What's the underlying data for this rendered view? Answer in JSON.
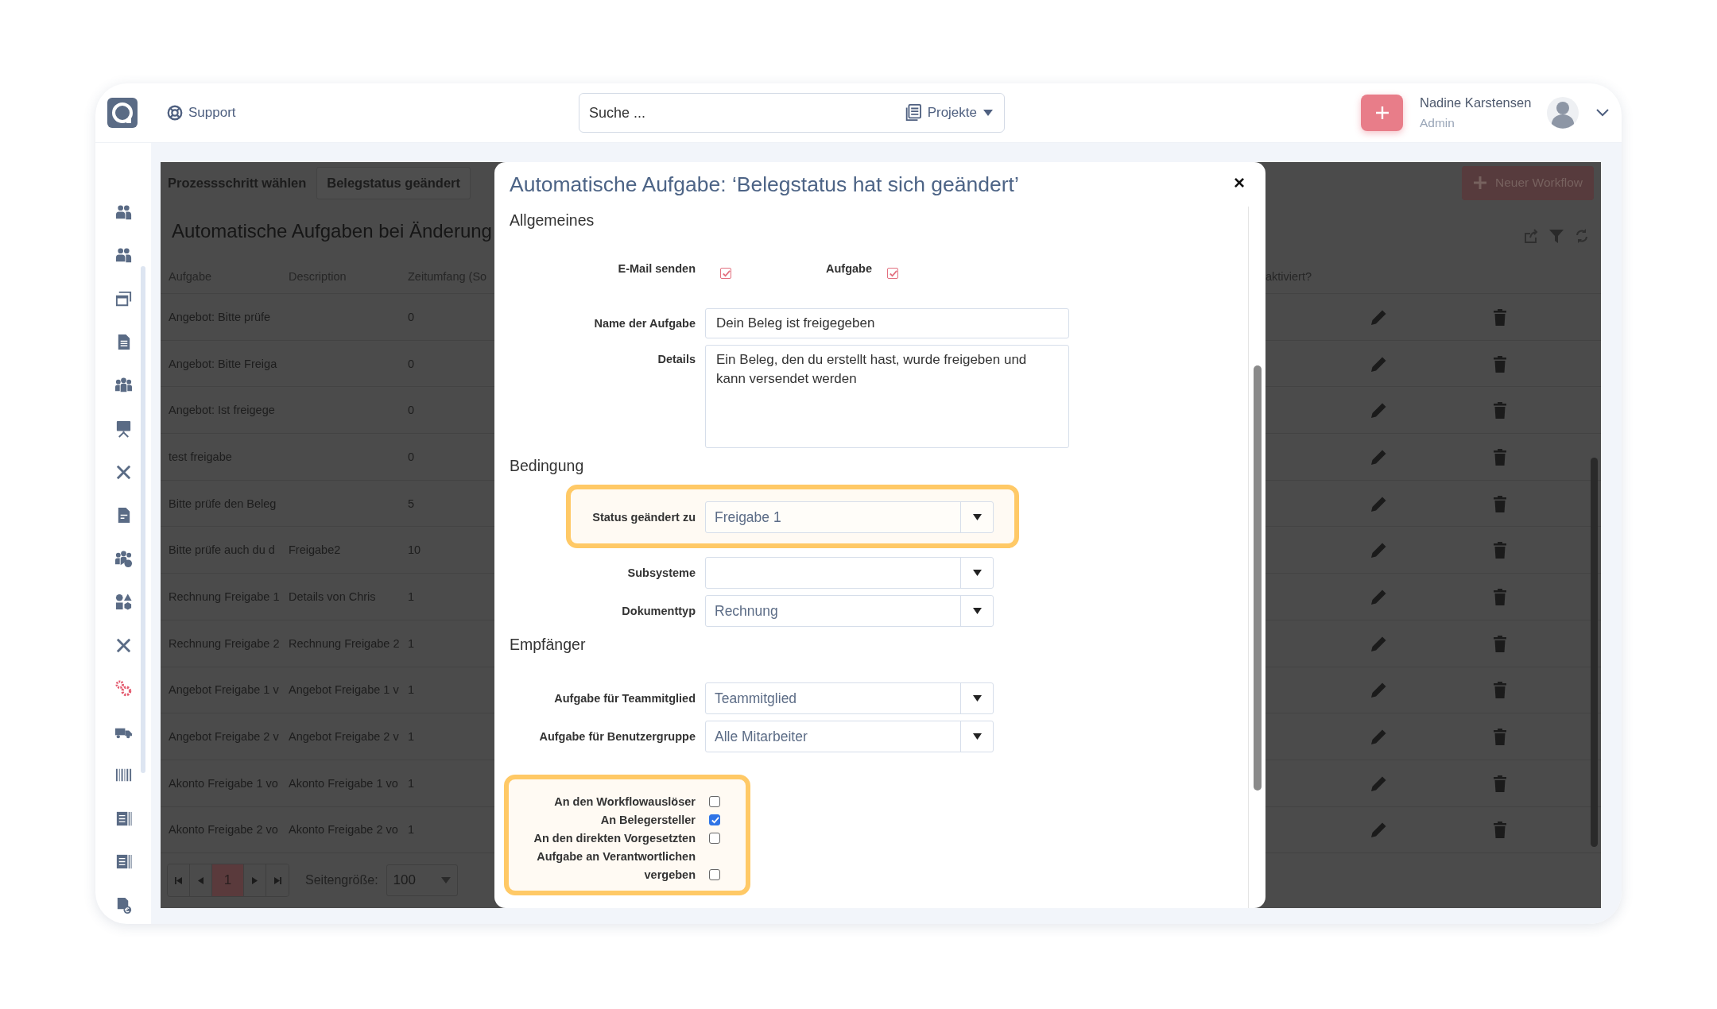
{
  "header": {
    "support": "Support",
    "search": {
      "placeholder": "Suche ...",
      "scope": "Projekte"
    },
    "user": {
      "name": "Nadine Karstensen",
      "role": "Admin"
    }
  },
  "sidebar": {
    "items": [
      {
        "kind": "users",
        "selected": false
      },
      {
        "kind": "users",
        "selected": false
      },
      {
        "kind": "windows",
        "selected": false
      },
      {
        "kind": "document",
        "selected": false
      },
      {
        "kind": "group",
        "selected": false
      },
      {
        "kind": "presentation",
        "selected": false
      },
      {
        "kind": "tools",
        "selected": false
      },
      {
        "kind": "document-edit",
        "selected": false
      },
      {
        "kind": "group-gear",
        "selected": false
      },
      {
        "kind": "shapes",
        "selected": false
      },
      {
        "kind": "tools",
        "selected": false
      },
      {
        "kind": "gear",
        "selected": true
      },
      {
        "kind": "truck",
        "selected": false
      },
      {
        "kind": "barcode",
        "selected": false
      },
      {
        "kind": "book",
        "selected": false
      },
      {
        "kind": "book",
        "selected": false
      },
      {
        "kind": "document-euro",
        "selected": false
      }
    ]
  },
  "workflow_page": {
    "tabs": [
      {
        "label": "Prozessschritt wählen",
        "selected": false
      },
      {
        "label": "Belegstatus geändert",
        "selected": true
      }
    ],
    "new_button": "Neuer Workflow",
    "heading": "Automatische Aufgaben bei Änderung",
    "table": {
      "columns": [
        "Aufgabe",
        "Description",
        "Zeitumfang (So",
        "aktiviert?"
      ],
      "rows": [
        {
          "task": "Angebot: Bitte prüfe",
          "time": "0"
        },
        {
          "task": "Angebot: Bitte Freiga",
          "time": "0"
        },
        {
          "task": "Angebot: Ist freigege",
          "time": "0"
        },
        {
          "task": "test freigabe",
          "time": "0"
        },
        {
          "task": "Bitte prüfe den Beleg",
          "time": "5"
        },
        {
          "task": "Bitte prüfe auch du d",
          "description": "Freigabe2",
          "time": "10"
        },
        {
          "task": "Rechnung Freigabe 1",
          "description": "Details von Chris",
          "time": "1"
        },
        {
          "task": "Rechnung Freigabe 2",
          "description": "Rechnung Freigabe 2",
          "time": "1"
        },
        {
          "task": "Angebot Freigabe 1 v",
          "description": "Angebot Freigabe 1 v",
          "time": "1"
        },
        {
          "task": "Angebot Freigabe 2 v",
          "description": "Angebot Freigabe 2 v",
          "time": "1"
        },
        {
          "task": "Akonto Freigabe 1 vo",
          "description": "Akonto Freigabe 1 vo",
          "time": "1"
        },
        {
          "task": "Akonto Freigabe 2 vo",
          "description": "Akonto Freigabe 2 vo",
          "time": "1"
        }
      ]
    },
    "pager": {
      "pages": [
        {
          "label": "1",
          "selected": true
        }
      ],
      "page_size_label": "Seitengröße:",
      "page_size": "100"
    }
  },
  "dialog": {
    "title": "Automatische Aufgabe: ‘Belegstatus hat sich geändert’",
    "close": "×",
    "sections": [
      {
        "heading": "Allgemeines",
        "fields": [
          {
            "kind": "check-pair",
            "items": [
              {
                "label": "E-Mail senden",
                "checked": true
              },
              {
                "label": "Aufgabe",
                "checked": true
              }
            ]
          },
          {
            "kind": "text",
            "label": "Name der Aufgabe",
            "value": "Dein Beleg ist freigegeben"
          },
          {
            "kind": "textarea",
            "label": "Details",
            "value": "Ein Beleg, den du erstellt hast, wurde freigeben und kann versendet werden"
          }
        ]
      },
      {
        "heading": "Bedingung",
        "fields": [
          {
            "kind": "select",
            "label": "Status geändert zu",
            "value": "Freigabe 1",
            "highlighted": true
          },
          {
            "kind": "select",
            "label": "Subsysteme"
          },
          {
            "kind": "select",
            "label": "Dokumenttyp",
            "value": "Rechnung"
          }
        ]
      },
      {
        "heading": "Empfänger",
        "fields": [
          {
            "kind": "select",
            "label": "Aufgabe für Teammitglied",
            "value": "Teammitglied"
          },
          {
            "kind": "select",
            "label": "Aufgabe für Benutzergruppe",
            "value": "Alle Mitarbeiter"
          },
          {
            "kind": "checklist",
            "highlighted": true,
            "items": [
              {
                "label": "An den Workflowauslöser",
                "checked": false
              },
              {
                "label": "An Belegersteller",
                "checked": true
              },
              {
                "label": "An den direkten Vorgesetzten",
                "checked": false
              },
              {
                "label": "Aufgabe an Verantwortlichen vergeben",
                "checked": false
              }
            ]
          }
        ]
      }
    ]
  }
}
